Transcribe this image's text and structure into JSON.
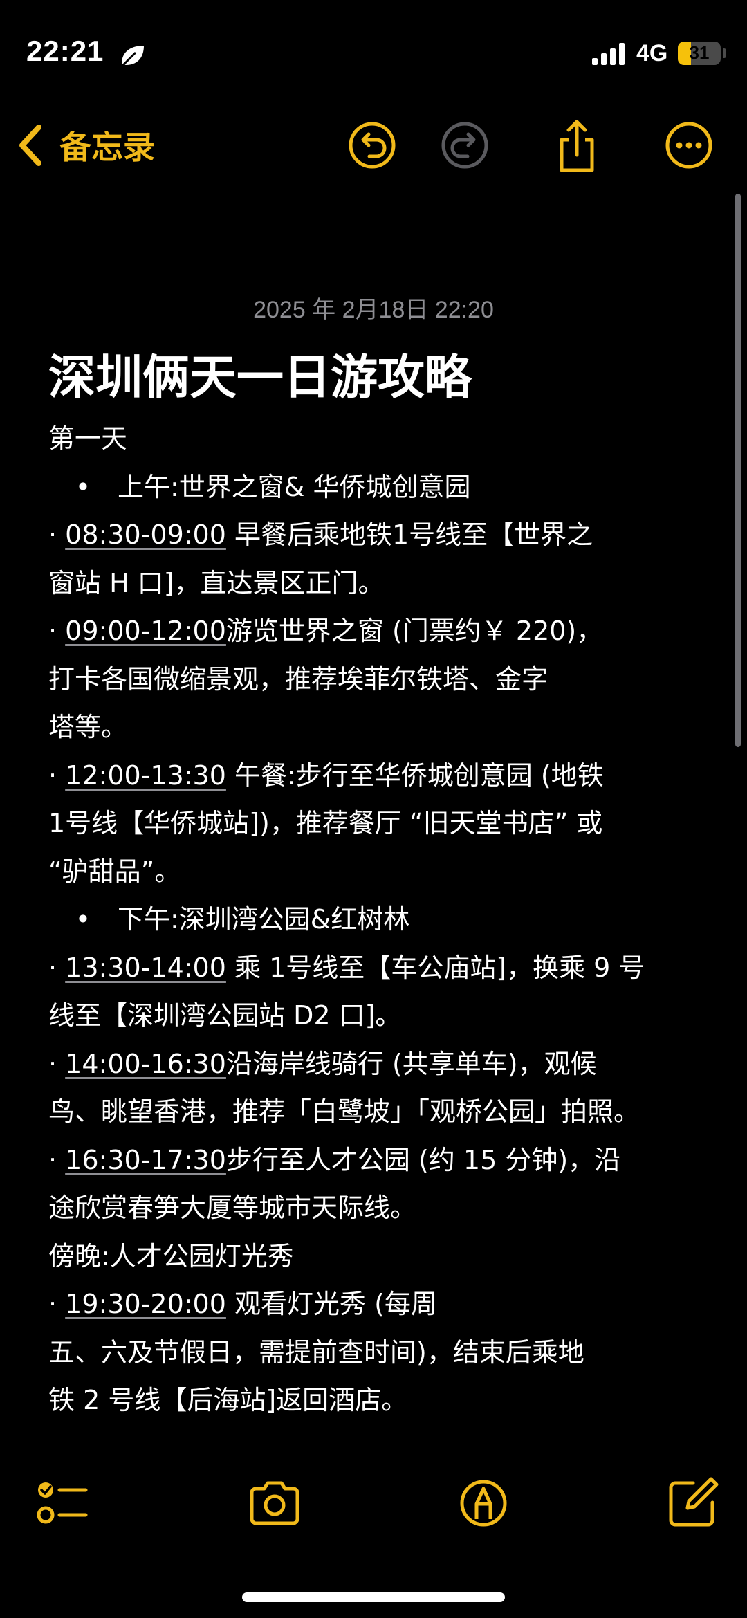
{
  "status_bar": {
    "time": "22:21",
    "network": "4G",
    "battery": "31",
    "battery_level": 0.31
  },
  "nav": {
    "back_label": "备忘录",
    "icons": [
      "undo-icon",
      "redo-icon",
      "share-icon",
      "more-icon"
    ]
  },
  "note": {
    "date": "2025 年 2月18日 22:20",
    "title": "深圳俩天一日游攻略",
    "lines": [
      {
        "parts": [
          {
            "t": "第一天"
          }
        ]
      },
      {
        "bullet": "•",
        "parts": [
          {
            "t": "上午:世界之窗& 华侨城创意园"
          }
        ]
      },
      {
        "parts": [
          {
            "t": "· "
          },
          {
            "t": "08:30-09:00",
            "u": true
          },
          {
            "t": " 早餐后乘地铁1号线至【世界之"
          }
        ]
      },
      {
        "parts": [
          {
            "t": "窗站 H 口]，直达景区正门。"
          }
        ]
      },
      {
        "parts": [
          {
            "t": "· "
          },
          {
            "t": "09:00-12:00",
            "u": true
          },
          {
            "t": "游览世界之窗 (门票约￥ 220)，"
          }
        ]
      },
      {
        "parts": [
          {
            "t": "打卡各国微缩景观，推荐埃菲尔铁塔、金字"
          }
        ]
      },
      {
        "parts": [
          {
            "t": "塔等。"
          }
        ]
      },
      {
        "parts": [
          {
            "t": "· "
          },
          {
            "t": "12:00-13:30",
            "u": true
          },
          {
            "t": " 午餐:步行至华侨城创意园 (地铁"
          }
        ]
      },
      {
        "parts": [
          {
            "t": "1号线【华侨城站])，推荐餐厅 “旧天堂书店” 或"
          }
        ]
      },
      {
        "parts": [
          {
            "t": "“驴甜品”。"
          }
        ]
      },
      {
        "bullet": "•",
        "parts": [
          {
            "t": "下午:深圳湾公园&红树林"
          }
        ]
      },
      {
        "parts": [
          {
            "t": "· "
          },
          {
            "t": "13:30-14:00",
            "u": true
          },
          {
            "t": " 乘 1号线至【车公庙站]，换乘 9 号"
          }
        ]
      },
      {
        "parts": [
          {
            "t": "线至【深圳湾公园站 D2 口]。"
          }
        ]
      },
      {
        "parts": [
          {
            "t": "· "
          },
          {
            "t": "14:00-16:30",
            "u": true
          },
          {
            "t": "沿海岸线骑行 (共享单车)，观候"
          }
        ]
      },
      {
        "parts": [
          {
            "t": "鸟、眺望香港，推荐「白鹭坡」「观桥公园」拍照。"
          }
        ]
      },
      {
        "parts": [
          {
            "t": "· "
          },
          {
            "t": "16:30-17:30",
            "u": true
          },
          {
            "t": "步行至人才公园 (约 15 分钟)，沿"
          }
        ]
      },
      {
        "parts": [
          {
            "t": "途欣赏春笋大厦等城市天际线。"
          }
        ]
      },
      {
        "parts": [
          {
            "t": "傍晚:人才公园灯光秀"
          }
        ]
      },
      {
        "parts": [
          {
            "t": "· "
          },
          {
            "t": "19:30-20:00",
            "u": true
          },
          {
            "t": " 观看灯光秀 (每周"
          }
        ]
      },
      {
        "parts": [
          {
            "t": "五、六及节假日，需提前查时间)，结束后乘地"
          }
        ]
      },
      {
        "parts": [
          {
            "t": "铁 2 号线【后海站]返回酒店。"
          }
        ]
      }
    ]
  },
  "toolbar": {
    "icons": [
      "checklist-icon",
      "camera-icon",
      "markup-icon",
      "compose-icon"
    ]
  },
  "colors": {
    "accent": "#f1b91a",
    "background": "#000000",
    "text": "#ffffff",
    "muted": "#8e8e93"
  }
}
